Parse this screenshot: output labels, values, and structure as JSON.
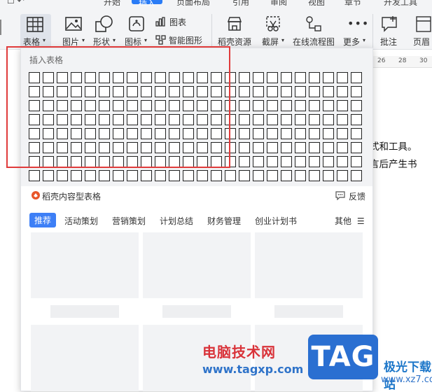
{
  "top_tabs": [
    "开始",
    "插入",
    "页面布局",
    "引用",
    "审阅",
    "视图",
    "章节",
    "开发工具"
  ],
  "ribbon": {
    "table_label": "表格",
    "picture_label": "图片",
    "shape_label": "形状",
    "icon_label": "图标",
    "chart_label": "图表",
    "smart_graphic_label": "智能图形",
    "daoke_resource_label": "稻壳资源",
    "screenshot_label": "截屏",
    "flowchart_label": "在线流程图",
    "more_label": "更多",
    "comment_label": "批注",
    "header_label": "页眉"
  },
  "ruler": {
    "marks": [
      "26",
      "28",
      "30"
    ]
  },
  "document": {
    "lines": [
      "式和工具。",
      "言后产生书"
    ]
  },
  "popup": {
    "title": "插入表格",
    "grid": {
      "rows": 8,
      "cols": 24
    },
    "daoke_label": "稻壳内容型表格",
    "feedback_label": "反馈",
    "categories": [
      "推荐",
      "活动策划",
      "营销策划",
      "计划总结",
      "财务管理",
      "创业计划书"
    ],
    "more_label": "其他"
  },
  "watermark": {
    "title": "电脑技术网",
    "url": "www.tagxp.com",
    "tag": "TAG",
    "site_name": "极光下载站",
    "site_url": "www.xz7.com"
  },
  "colors": {
    "accent": "#2a7cf6",
    "highlight_box": "#e03b3b",
    "watermark_red": "#d9333a",
    "watermark_blue": "#2a6fd1"
  }
}
